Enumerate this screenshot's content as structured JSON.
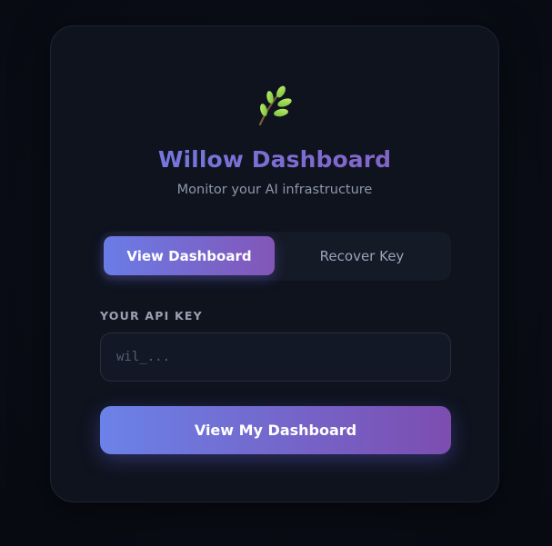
{
  "brand": {
    "logo_icon": "leaf-sprig-icon",
    "title": "Willow Dashboard",
    "subtitle": "Monitor your AI infrastructure"
  },
  "tabs": [
    {
      "label": "View Dashboard",
      "active": true
    },
    {
      "label": "Recover Key",
      "active": false
    }
  ],
  "form": {
    "api_key_label": "YOUR API KEY",
    "api_key_placeholder": "wil_...",
    "api_key_value": "",
    "submit_label": "View My Dashboard"
  },
  "colors": {
    "accent_start": "#6b82e8",
    "accent_end": "#7d4db0",
    "background": "#0a0d16",
    "card": "#0e131e",
    "leaf_green": "#9bd84a"
  }
}
